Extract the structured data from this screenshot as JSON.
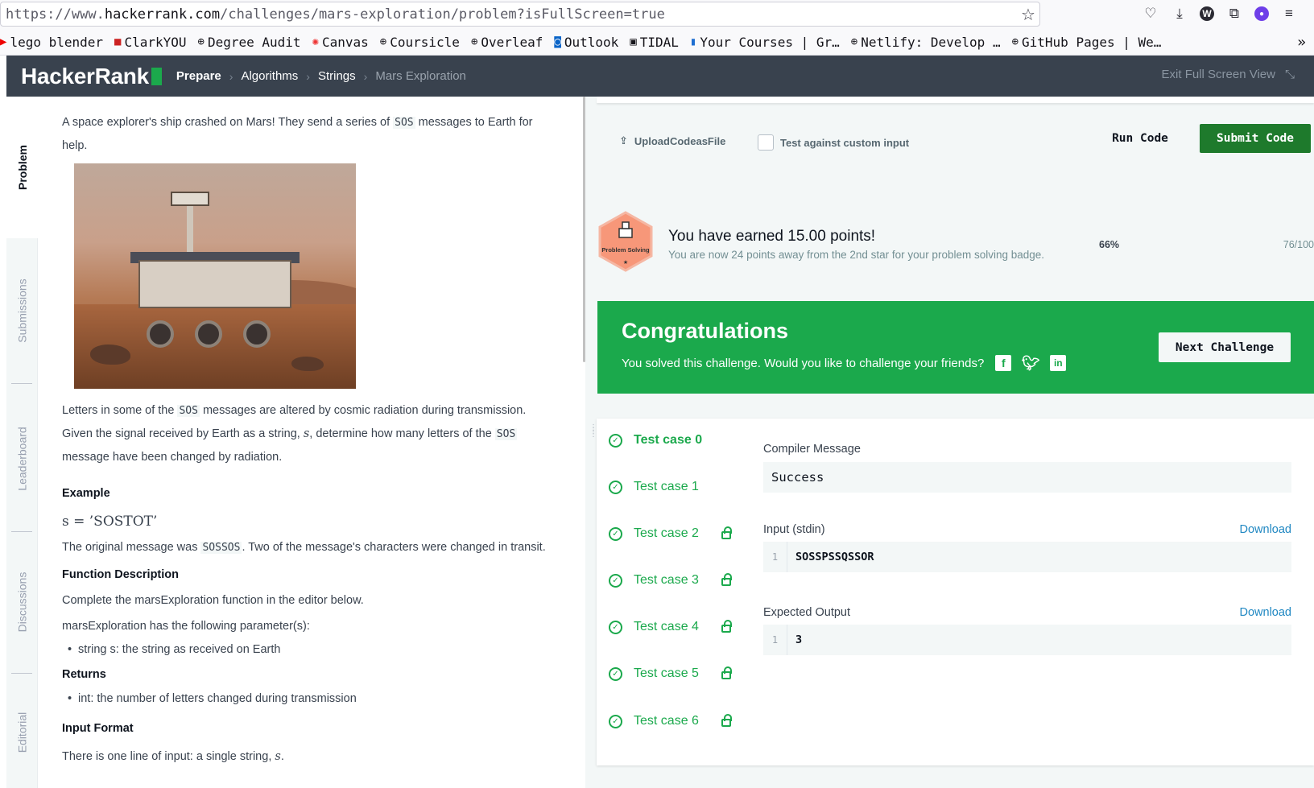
{
  "browser": {
    "url_prefix": "https://www.",
    "url_host": "hackerrank.com",
    "url_path": "/challenges/mars-exploration/problem?isFullScreen=true",
    "bookmarks": [
      "lego blender",
      "ClarkYOU",
      "Degree Audit",
      "Canvas",
      "Coursicle",
      "Overleaf",
      "Outlook",
      "TIDAL",
      "Your Courses | Gr…",
      "Netlify: Develop …",
      "GitHub Pages | We…"
    ]
  },
  "header": {
    "logo": "HackerRank",
    "crumbs": [
      "Prepare",
      "Algorithms",
      "Strings",
      "Mars Exploration"
    ],
    "exit_fullscreen": "Exit Full Screen View"
  },
  "tabs": [
    "Problem",
    "Submissions",
    "Leaderboard",
    "Discussions",
    "Editorial"
  ],
  "problem": {
    "intro_a": "A space explorer's ship crashed on Mars! They send a series of ",
    "sos": "SOS",
    "intro_b": " messages to Earth for help.",
    "p2_a": "Letters in some of the ",
    "p2_b": " messages are altered by cosmic radiation during transmission. Given the signal received by Earth as a string, ",
    "p2_var": "s",
    "p2_c": ", determine how many letters of the ",
    "p2_d": " message have been changed by radiation.",
    "example_heading": "Example",
    "example_math": "s = ’SOSTOT’",
    "orig_a": "The original message was ",
    "orig_code": "SOSSOS",
    "orig_b": ". Two of the message's characters were changed in transit.",
    "func_heading": "Function Description",
    "func_text": "Complete the marsExploration function in the editor below.",
    "params_text": "marsExploration has the following parameter(s):",
    "param_item": "string s: the string as received on Earth",
    "returns_heading": "Returns",
    "returns_item": "int: the number of letters changed during transmission",
    "input_heading": "Input Format",
    "input_text_a": "There is one line of input: a single string, ",
    "input_var": "s",
    "input_text_b": "."
  },
  "editor_bar": {
    "upload": "UploadCodeasFile",
    "custom_input": "Test against custom input",
    "run": "Run Code",
    "submit": "Submit Code"
  },
  "points": {
    "badge": "Problem Solving",
    "title": "You have earned 15.00 points!",
    "subtitle": "You are now 24 points away from the 2nd star for your problem solving badge.",
    "percent": "66%",
    "score": "76/100"
  },
  "congrats": {
    "title": "Congratulations",
    "text": "You solved this challenge. Would you like to challenge your friends?",
    "next": "Next Challenge"
  },
  "tests": {
    "cases": [
      "Test case 0",
      "Test case 1",
      "Test case 2",
      "Test case 3",
      "Test case 4",
      "Test case 5",
      "Test case 6"
    ],
    "compiler_label": "Compiler Message",
    "compiler_value": "Success",
    "input_label": "Input (stdin)",
    "input_line": "1",
    "input_value": "SOSSPSSQSSOR",
    "expected_label": "Expected Output",
    "expected_line": "1",
    "expected_value": "3",
    "download": "Download"
  },
  "colors": {
    "green": "#1ba94c",
    "header": "#39424e",
    "link": "#1f87c2"
  }
}
